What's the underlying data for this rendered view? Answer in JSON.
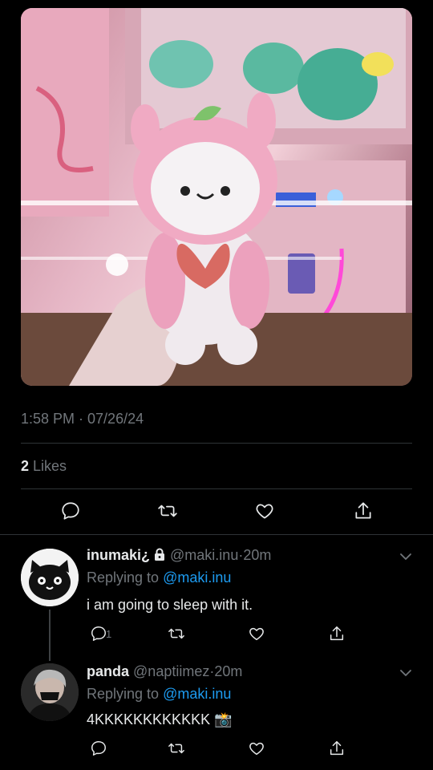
{
  "tweet": {
    "timestamp": "1:58 PM · 07/26/24",
    "likes_count": "2",
    "likes_label": "Likes"
  },
  "replies": [
    {
      "name": "inumaki¿",
      "handle": "@maki.inu",
      "dot": "·",
      "time": "20m",
      "replying_prefix": "Replying to",
      "replying_to": "@maki.inu",
      "text": "i am going to sleep with it.",
      "reply_count": "1",
      "locked": true
    },
    {
      "name": "panda",
      "handle": "@naptiimez",
      "dot": "·",
      "time": "20m",
      "replying_prefix": "Replying to",
      "replying_to": "@maki.inu",
      "text": "4KKKKKKKKKKKK 📸"
    }
  ],
  "colors": {
    "background": "#000000",
    "text_primary": "#e7e9ea",
    "text_secondary": "#71767b",
    "link": "#1d9bf0",
    "divider": "#2f3336"
  },
  "icons": [
    "reply-icon",
    "retweet-icon",
    "like-icon",
    "share-icon",
    "chevron-down-icon",
    "lock-icon"
  ]
}
